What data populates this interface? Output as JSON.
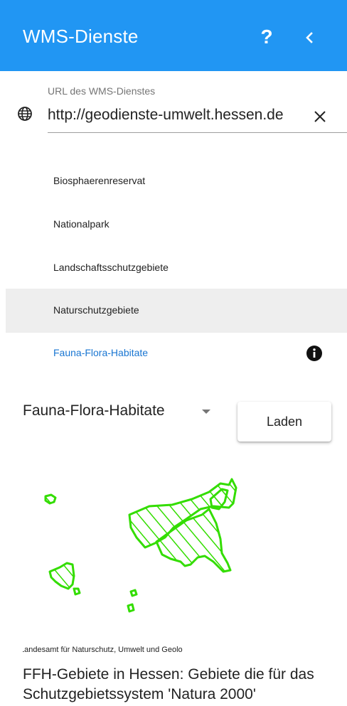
{
  "header": {
    "title": "WMS-Dienste",
    "help_label": "?",
    "back_icon": "chevron-left-icon"
  },
  "url_field": {
    "label": "URL des WMS-Dienstes",
    "value": "http://geodienste-umwelt.hessen.de",
    "icon": "globe-icon",
    "clear_icon": "close-icon"
  },
  "layers": [
    {
      "label": "Biosphaerenreservat"
    },
    {
      "label": "Nationalpark"
    },
    {
      "label": "Landschaftsschutzgebiete"
    },
    {
      "label": "Naturschutzgebiete",
      "state": "hover"
    },
    {
      "label": "Fauna-Flora-Habitate",
      "state": "selected"
    }
  ],
  "layer_select": {
    "value": "Fauna-Flora-Habitate"
  },
  "load_button": {
    "label": "Laden"
  },
  "preview": {
    "attribution": "Landesamt für Naturschutz, Umwelt und Geolo",
    "description": "FFH-Gebiete in Hessen: Gebiete die für das Schutzgebietssystem 'Natura 2000'"
  },
  "colors": {
    "header": "#2196f3",
    "accent": "#1976d2",
    "map_polygon": "#33dd00"
  }
}
